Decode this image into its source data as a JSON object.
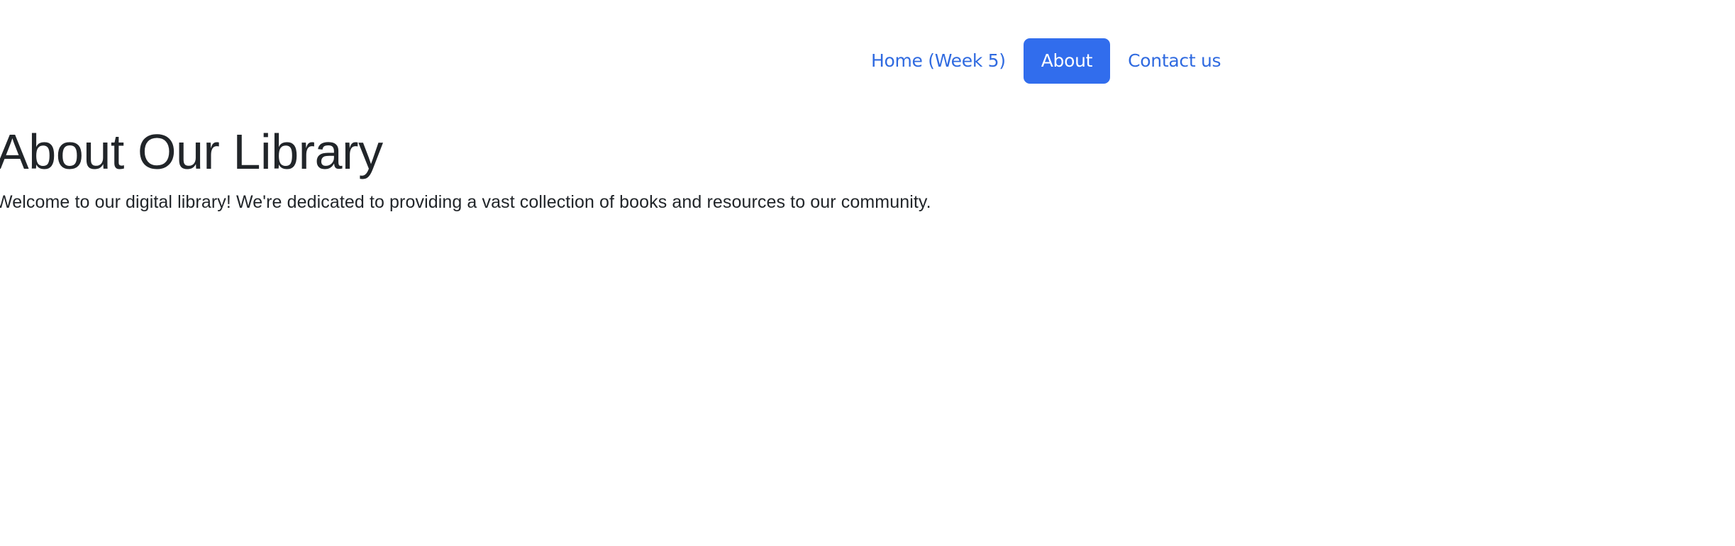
{
  "nav": {
    "items": [
      {
        "label": "Home (Week 5)",
        "active": false
      },
      {
        "label": "About",
        "active": true
      },
      {
        "label": "Contact us",
        "active": false
      }
    ]
  },
  "main": {
    "title": "About Our Library",
    "description": "Welcome to our digital library! We're dedicated to providing a vast collection of books and resources to our community."
  },
  "colors": {
    "link": "#2f6ae0",
    "active_pill": "#316ded",
    "text": "#212529",
    "background": "#ffffff"
  }
}
